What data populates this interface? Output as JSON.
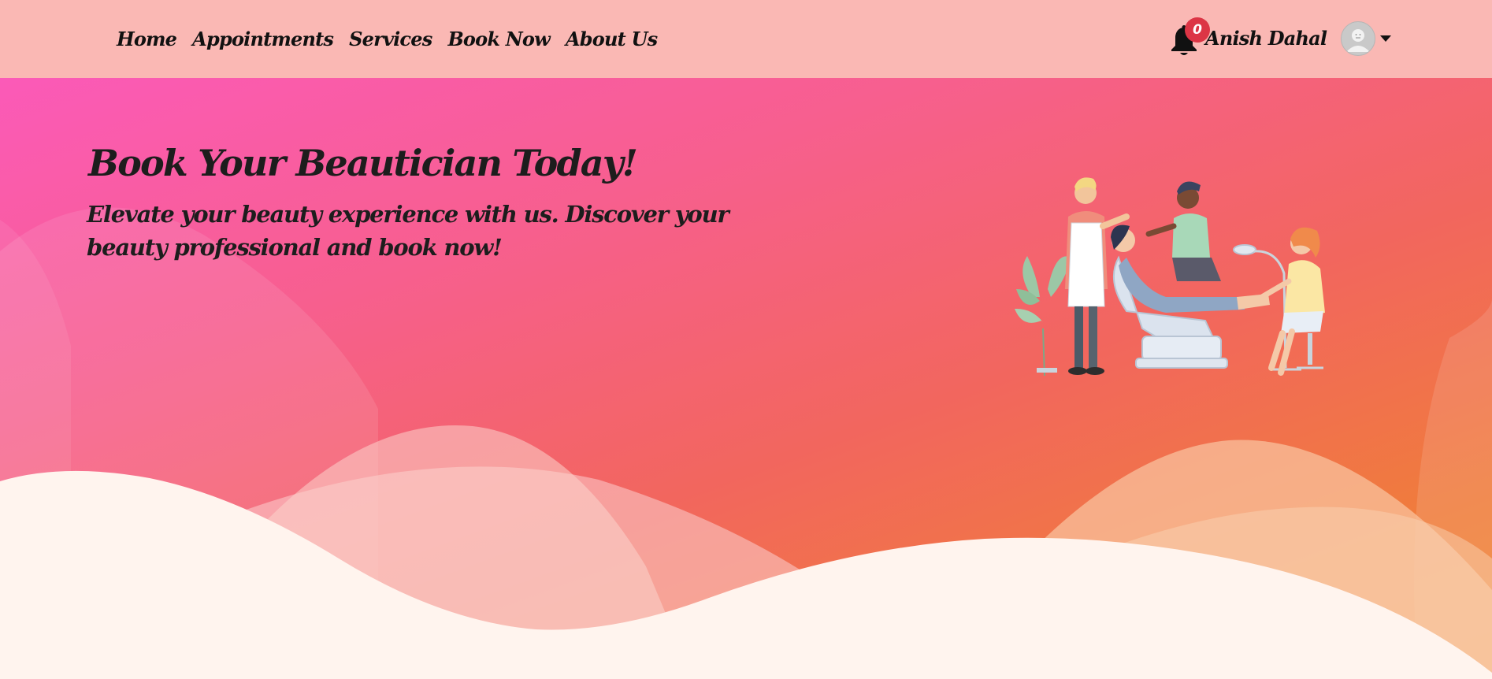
{
  "nav": {
    "links": [
      "Home",
      "Appointments",
      "Services",
      "Book Now",
      "About Us"
    ]
  },
  "user": {
    "notification_count": "0",
    "name": "Anish Dahal"
  },
  "hero": {
    "title": "Book Your Beautician Today!",
    "subtitle": "Elevate your beauty experience with us. Discover your beauty professional and book now!"
  },
  "colors": {
    "navbar_bg": "#fab8b4",
    "badge": "#dc3545",
    "gradient_start": "#fb5ab8",
    "gradient_end": "#f0862d",
    "wave_front": "#fff4ee"
  },
  "icons": {
    "notification": "bell-icon",
    "avatar": "user-avatar-icon",
    "dropdown": "caret-down-icon"
  }
}
